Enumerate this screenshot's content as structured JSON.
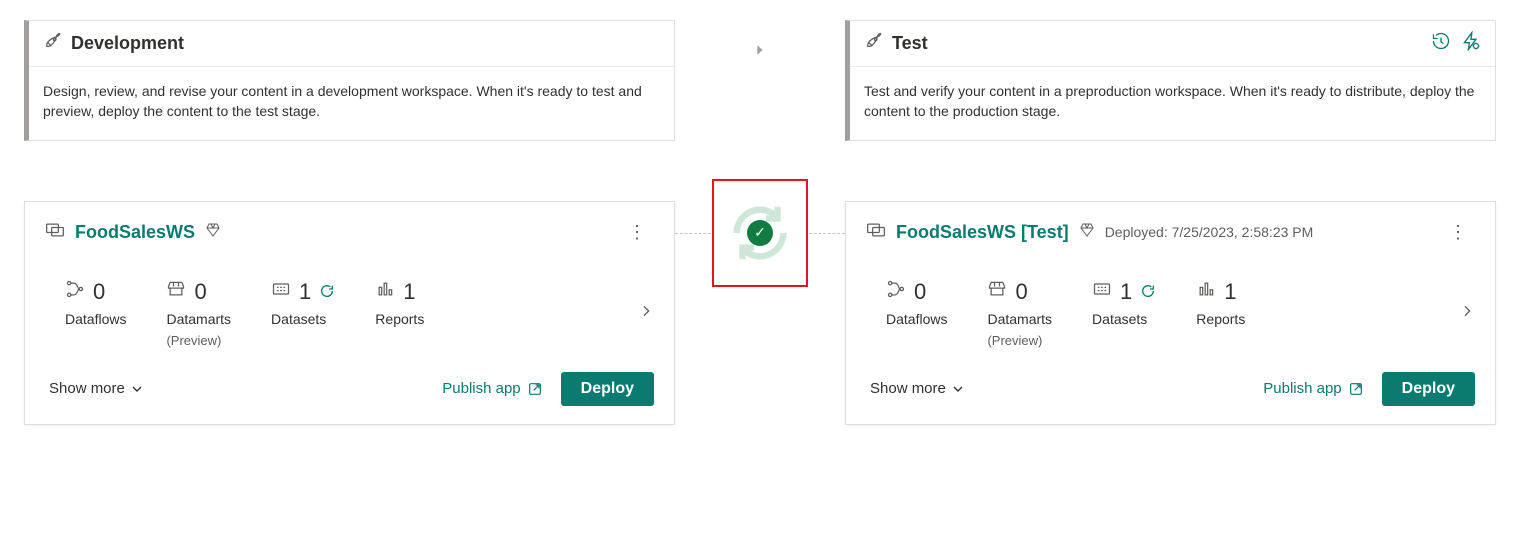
{
  "stages": {
    "dev": {
      "title": "Development",
      "description": "Design, review, and revise your content in a development workspace. When it's ready to test and preview, deploy the content to the test stage."
    },
    "test": {
      "title": "Test",
      "description": "Test and verify your content in a preproduction workspace. When it's ready to distribute, deploy the content to the production stage."
    }
  },
  "workspaces": {
    "dev": {
      "name": "FoodSalesWS",
      "deployed": "",
      "stats": {
        "dataflows": {
          "value": "0",
          "label": "Dataflows"
        },
        "datamarts": {
          "value": "0",
          "label": "Datamarts",
          "sub": "(Preview)"
        },
        "datasets": {
          "value": "1",
          "label": "Datasets",
          "refresh": true
        },
        "reports": {
          "value": "1",
          "label": "Reports"
        }
      },
      "show_more": "Show more",
      "publish": "Publish app",
      "deploy": "Deploy"
    },
    "test": {
      "name": "FoodSalesWS [Test]",
      "deployed": "Deployed: 7/25/2023, 2:58:23 PM",
      "stats": {
        "dataflows": {
          "value": "0",
          "label": "Dataflows"
        },
        "datamarts": {
          "value": "0",
          "label": "Datamarts",
          "sub": "(Preview)"
        },
        "datasets": {
          "value": "1",
          "label": "Datasets",
          "refresh": true
        },
        "reports": {
          "value": "1",
          "label": "Reports"
        }
      },
      "show_more": "Show more",
      "publish": "Publish app",
      "deploy": "Deploy"
    }
  }
}
